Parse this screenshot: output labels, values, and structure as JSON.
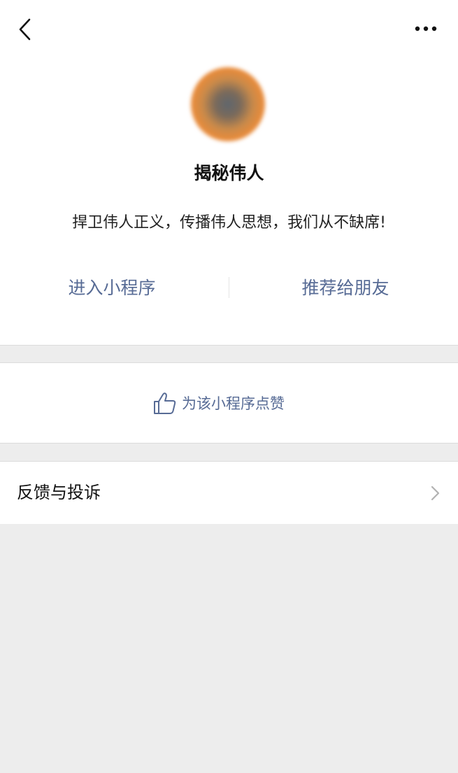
{
  "header": {
    "back_icon": "chevron-left-icon",
    "more_icon": "more-horizontal-icon"
  },
  "profile": {
    "avatar_icon": "mini-program-avatar",
    "name": "揭秘伟人",
    "description": "捍卫伟人正义，传播伟人思想，我们从不缺席!"
  },
  "actions": {
    "enter_label": "进入小程序",
    "recommend_label": "推荐给朋友"
  },
  "like": {
    "icon": "thumbs-up-icon",
    "label": "为该小程序点赞"
  },
  "feedback": {
    "label": "反馈与投诉",
    "arrow_icon": "chevron-right-icon"
  },
  "colors": {
    "link": "#576b95",
    "background": "#ededed",
    "card": "#ffffff"
  }
}
